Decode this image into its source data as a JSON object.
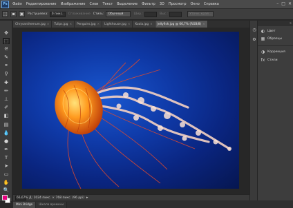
{
  "app": {
    "logo": "Ps",
    "menu": [
      "Файл",
      "Редактирование",
      "Изображение",
      "Слои",
      "Текст",
      "Выделение",
      "Фильтр",
      "3D",
      "Просмотр",
      "Окно",
      "Справка"
    ],
    "window_controls": [
      "–",
      "□",
      "✕"
    ]
  },
  "options_bar": {
    "mode_label": "Растушевка:",
    "feather_value": "0 пикс.",
    "smoothing_label": "Сглаживание",
    "style_label": "Стиль:",
    "style_value": "Обычный",
    "width_label": "Шир.:",
    "height_label": "Выс.:",
    "refine_button": "Уточн. край..."
  },
  "tabs": [
    {
      "label": "Chrysanthemum.jpg",
      "active": false
    },
    {
      "label": "Tulips.jpg",
      "active": false
    },
    {
      "label": "Penguins.jpg",
      "active": false
    },
    {
      "label": "Lighthouse.jpg",
      "active": false
    },
    {
      "label": "Koala.jpg",
      "active": false
    },
    {
      "label": "Jellyfish.jpg @ 66,7% (RGB/8)",
      "active": true
    }
  ],
  "status": {
    "zoom": "66,67%",
    "doc_info": "Д: 1024 пикс. × 768 пикс. (96 ppi)"
  },
  "bottom_tabs": [
    {
      "label": "Mini Bridge",
      "active": true
    },
    {
      "label": "Шкала времени",
      "active": false
    }
  ],
  "panels": {
    "groups": [
      [
        {
          "icon": "color-swatch-icon",
          "label": "Цвет"
        },
        {
          "icon": "swatches-grid-icon",
          "label": "Образцы"
        }
      ],
      [
        {
          "icon": "adjustments-icon",
          "label": "Коррекция"
        },
        {
          "icon": "styles-icon",
          "label": "Стили"
        }
      ]
    ]
  },
  "colors": {
    "foreground": "#e6007e",
    "background": "#ffffff",
    "canvas_blue": "#0f3aa8"
  }
}
